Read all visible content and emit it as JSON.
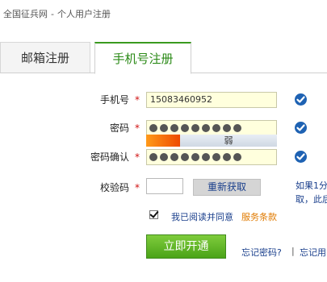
{
  "breadcrumb": {
    "site": "全国征兵网",
    "separator": "-",
    "current": "个人用户注册"
  },
  "tabs": [
    {
      "label": "邮箱注册",
      "active": false
    },
    {
      "label": "手机号注册",
      "active": true
    }
  ],
  "form": {
    "phone": {
      "label": "手机号",
      "required_mark": "*",
      "value": "15083460952",
      "valid": true
    },
    "password": {
      "label": "密码",
      "required_mark": "*",
      "masked_length": 9,
      "valid": true,
      "strength": {
        "label": "弱",
        "level": 1,
        "levels": 3
      }
    },
    "confirm": {
      "label": "密码确认",
      "required_mark": "*",
      "masked_length": 9,
      "valid": true
    },
    "captcha": {
      "label": "校验码",
      "required_mark": "*",
      "value": "",
      "refresh_label": "重新获取",
      "hint_line1": "如果1分",
      "hint_line2": "取，此后"
    },
    "agreement": {
      "checked": true,
      "text": "我已阅读并同意",
      "link": "服务条款"
    },
    "submit_label": "立即开通"
  },
  "footer": {
    "forgot_password": "忘记密码?",
    "separator": "|",
    "forgot_user": "忘记用"
  },
  "colors": {
    "accent_green": "#2b8a17",
    "link_blue": "#1a3f8c",
    "required_red": "#d01010",
    "field_bg": "#ffffdd"
  }
}
